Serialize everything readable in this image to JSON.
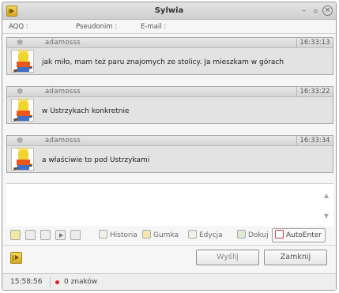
{
  "window": {
    "title": "Sylwia"
  },
  "info": {
    "field1": "AQQ :",
    "field2": "Pseudonim :",
    "field3": "E-mail :"
  },
  "messages": [
    {
      "nick": "adamosss",
      "time": "16:33:13",
      "text": "jak miło, mam też paru znajomych ze stolicy. Ja mieszkam w górach"
    },
    {
      "nick": "adamosss",
      "time": "16:33:22",
      "text": "w Ustrzykach konkretnie"
    },
    {
      "nick": "adamosss",
      "time": "16:33:34",
      "text": "a właściwie to pod Ustrzykami"
    }
  ],
  "toolbar": {
    "historia": "Historia",
    "gumka": "Gumka",
    "edycja": "Edycja",
    "dokuj": "Dokuj",
    "autoenter": "AutoEnter"
  },
  "buttons": {
    "send": "Wyślij",
    "close": "Zamknij"
  },
  "status": {
    "time": "15:58:56",
    "chars": "0 znaków"
  },
  "icons": {
    "app": "play-pause-icon",
    "message": "paw-icon",
    "avatar": "cartoon-avatar"
  },
  "colors": {
    "status_dot": "#dd2222",
    "accent": "#d9a820"
  }
}
